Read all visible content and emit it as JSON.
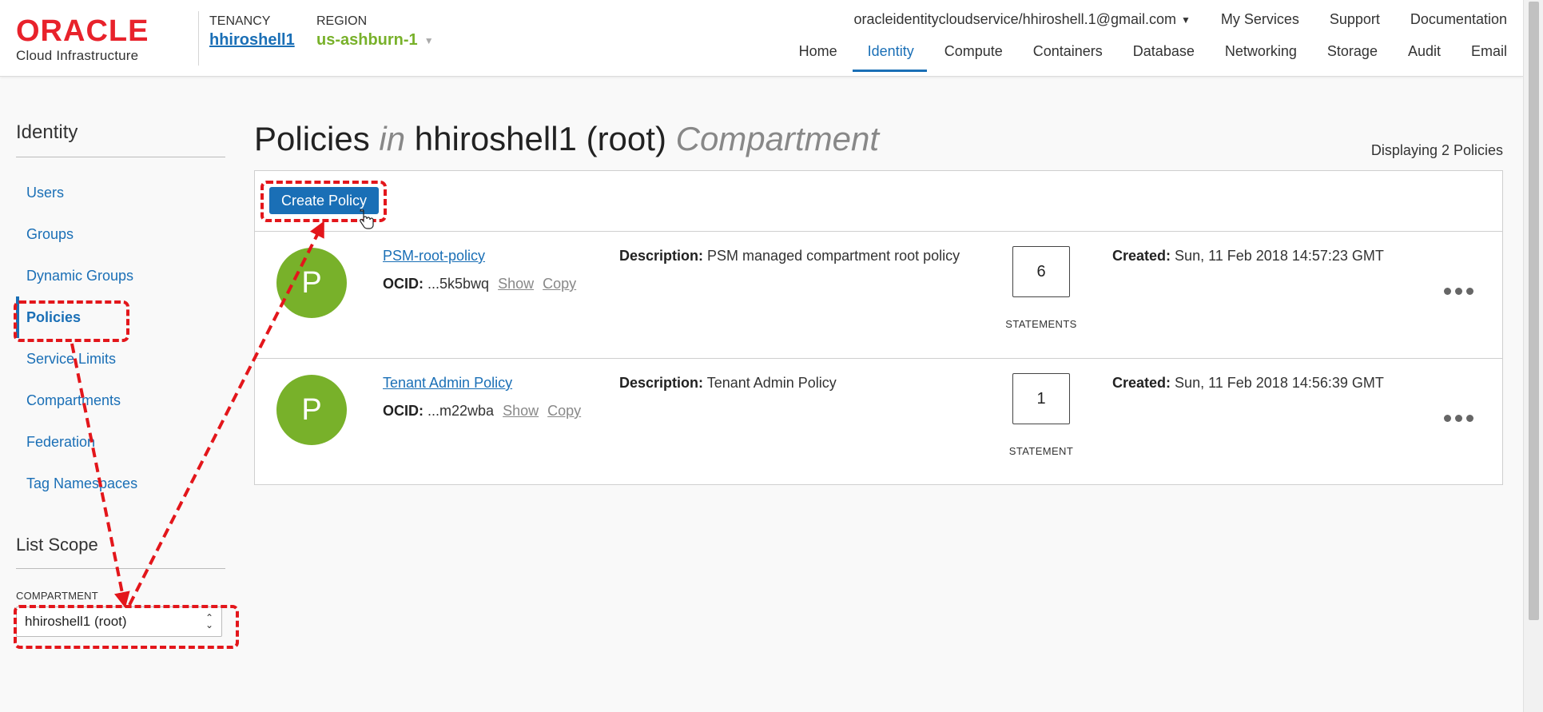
{
  "header": {
    "logo_word": "ORACLE",
    "logo_sub": "Cloud Infrastructure",
    "tenancy_label": "TENANCY",
    "tenancy_value": "hhiroshell1",
    "region_label": "REGION",
    "region_value": "us-ashburn-1",
    "user": "oracleidentitycloudservice/hhiroshell.1@gmail.com",
    "top_links": [
      "My Services",
      "Support",
      "Documentation"
    ],
    "nav": [
      "Home",
      "Identity",
      "Compute",
      "Containers",
      "Database",
      "Networking",
      "Storage",
      "Audit",
      "Email"
    ],
    "active_nav": "Identity"
  },
  "sidebar": {
    "title": "Identity",
    "items": [
      "Users",
      "Groups",
      "Dynamic Groups",
      "Policies",
      "Service Limits",
      "Compartments",
      "Federation",
      "Tag Namespaces"
    ],
    "active_item": "Policies",
    "scope_title": "List Scope",
    "compartment_label": "COMPARTMENT",
    "compartment_value": "hhiroshell1 (root)"
  },
  "main": {
    "title_prefix": "Policies",
    "title_in": "in",
    "title_name": "hhiroshell1 (root)",
    "title_suffix": "Compartment",
    "count_text": "Displaying 2 Policies",
    "create_button": "Create Policy",
    "policies": [
      {
        "avatar": "P",
        "name": "PSM-root-policy",
        "ocid_label": "OCID:",
        "ocid": "...5k5bwq",
        "show": "Show",
        "copy": "Copy",
        "desc_label": "Description:",
        "description": "PSM managed compartment root policy",
        "statements": "6",
        "statements_label": "STATEMENTS",
        "created_label": "Created:",
        "created": "Sun, 11 Feb 2018 14:57:23 GMT"
      },
      {
        "avatar": "P",
        "name": "Tenant Admin Policy",
        "ocid_label": "OCID:",
        "ocid": "...m22wba",
        "show": "Show",
        "copy": "Copy",
        "desc_label": "Description:",
        "description": "Tenant Admin Policy",
        "statements": "1",
        "statements_label": "STATEMENT",
        "created_label": "Created:",
        "created": "Sun, 11 Feb 2018 14:56:39 GMT"
      }
    ]
  },
  "colors": {
    "oracle_red": "#e8222b",
    "link_blue": "#1a6fb6",
    "region_green": "#78b12a",
    "annotation_red": "#e3161b"
  }
}
